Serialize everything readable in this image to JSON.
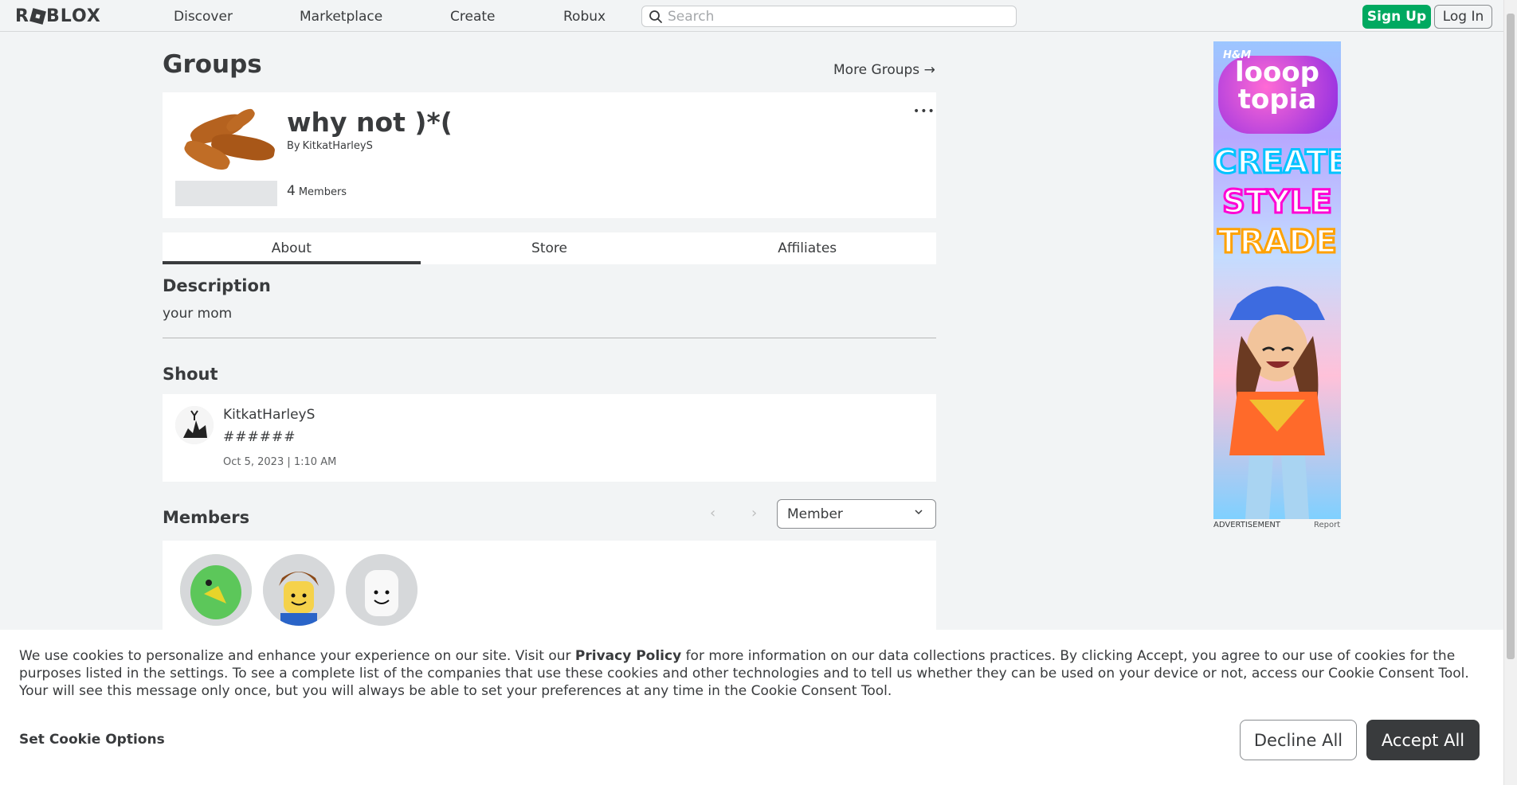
{
  "nav": {
    "logo_text": "ROBLOX",
    "links": [
      "Discover",
      "Marketplace",
      "Create",
      "Robux"
    ],
    "search_placeholder": "Search",
    "signup_label": "Sign Up",
    "login_label": "Log In"
  },
  "page": {
    "title": "Groups",
    "more_groups": "More Groups →"
  },
  "group": {
    "name": "why not )*(",
    "by_label": "By",
    "owner": "KitkatHarleyS",
    "member_count": "4",
    "member_label": "Members",
    "more_menu": "•••"
  },
  "tabs": [
    "About",
    "Store",
    "Affiliates"
  ],
  "about": {
    "description_heading": "Description",
    "description_text": "your mom",
    "shout_heading": "Shout",
    "shout": {
      "user": "KitkatHarleyS",
      "body": "######",
      "date": "Oct 5, 2023 | 1:10 AM"
    },
    "members_heading": "Members",
    "role_select_value": "Member",
    "pager_prev": "‹",
    "pager_next": "›"
  },
  "ad": {
    "brand": "H&M",
    "headline": "looop topia",
    "word1": "CREATE",
    "word2": "STYLE",
    "word3": "TRADE",
    "label": "ADVERTISEMENT",
    "report": "Report"
  },
  "cookie": {
    "text_before_link": "We use cookies to personalize and enhance your experience on our site. Visit our ",
    "link_text": "Privacy Policy",
    "text_after_link": " for more information on our data collections practices. By clicking Accept, you agree to our use of cookies for the purposes listed in the settings. To see a complete list of the companies that use these cookies and other technologies and to tell us whether they can be used on your device or not, access our Cookie Consent Tool. Your will see this message only once, but you will always be able to set your preferences at any time in the Cookie Consent Tool.",
    "set_options": "Set Cookie Options",
    "decline_label": "Decline All",
    "accept_label": "Accept All"
  },
  "colors": {
    "accent_green": "#00a960",
    "text_dark": "#393b3d",
    "background": "#f2f4f5",
    "accept_button": "#393b3d"
  },
  "icons": {
    "search": "search-icon",
    "chevron": "chevron-down-icon",
    "arrow": "arrow-right-icon",
    "more": "more-dots-icon"
  }
}
